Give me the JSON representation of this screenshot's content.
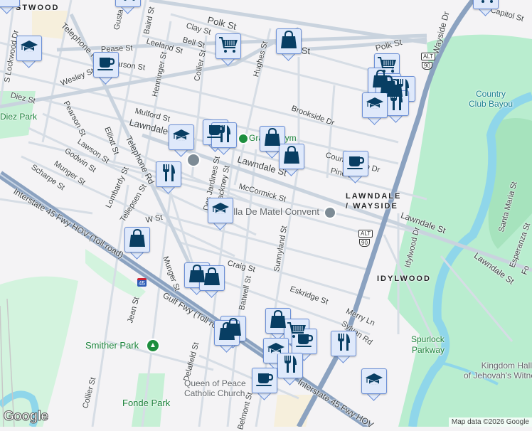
{
  "labels": {
    "eastwood": "STWOOD",
    "polk_w": "Polk St",
    "polk_mid": "Polk St",
    "polk_e": "Polk St",
    "clay": "Clay St",
    "bell": "Bell St",
    "leeland": "Leeland St",
    "baird": "Baird St",
    "gustav": "Gusta",
    "telephone_n": "Telephone Rd",
    "pease": "Pease St",
    "pearson_n": "Pearson St",
    "wesley": "Wesley St",
    "henninger": "Henninger St",
    "collier_n": "Collier St",
    "hughes": "Hughes St",
    "diez": "Diez St",
    "lockwood": "S Lockwood Dr",
    "mulford": "Mulford St",
    "lawndale_w": "Lawndale St",
    "lawndale_mid": "Lawndale St",
    "pearson_s": "Pearson St",
    "elliott": "Elliott St",
    "lawson": "Lawson St",
    "godwin": "Godwin St",
    "munger_n": "Munger St",
    "scharpe": "Scharpe St",
    "telephone_s": "Telephone Rd",
    "lombardy": "Lombardy St",
    "tellepsen": "Tellepsen St",
    "w_st": "W St",
    "desjardines": "Des Jardines St",
    "hackney": "Hackney St",
    "mccormick": "McCormick St",
    "brookside": "Brookside Dr",
    "countryclub_dr": "Country Club Dr",
    "pine": "Pine Dr",
    "wayside": "Wayside Dr",
    "capitol": "Capitol St",
    "lawndale_e1": "Lawndale St",
    "lawndale_e2": "Lawndale St",
    "idylwood_dr": "Idylwood Dr",
    "santamaria": "Santa Maria St",
    "esperanza": "Esperanza St",
    "fo": "Fo",
    "sunnyland": "Sunnyland St",
    "craig": "Craig St",
    "munger_s": "Munger St",
    "jean": "Jean St",
    "gulf_fwy": "Gulf Fwy (Toll road)",
    "i45_w": "Interstate 45 Fwy HOV (Toll road)",
    "i45_e": "Interstate 45 Fwy HOV",
    "eskridge": "Eskridge St",
    "merry": "Merry Ln",
    "sylvan": "Sylvan Rd",
    "delafield": "Delafield St",
    "collier_s": "Collier St",
    "batwell": "Batwell St",
    "belmont": "Belmont St"
  },
  "places": {
    "diez_park": "Diez Park",
    "gym": "Gravity Gym",
    "convent": "Villa De Matel Convent",
    "country_club_bayou_1": "Country",
    "country_club_bayou_2": "Club Bayou",
    "lawndale_wayside_1": "LAWNDALE",
    "lawndale_wayside_2": "/ WAYSIDE",
    "idylwood": "IDYLWOOD",
    "spurlock_1": "Spurlock",
    "spurlock_2": "Parkway",
    "kingdom_1": "Kingdom Hall",
    "kingdom_2": "of Jehovah's Witnesses",
    "smither_park": "Smither Park",
    "fonde_park": "Fonde Park",
    "queen_1": "Queen of Peace",
    "queen_2": "Catholic Church"
  },
  "shields": {
    "alt": "ALT",
    "us90": "90",
    "i45": "45"
  },
  "markers": [
    {
      "type": "school"
    },
    {
      "type": "cup"
    },
    {
      "type": "cart"
    },
    {
      "type": "bag"
    },
    {
      "type": "school"
    },
    {
      "type": "cart"
    },
    {
      "type": "cart"
    },
    {
      "type": "cart"
    },
    {
      "type": "bag"
    },
    {
      "type": "bag"
    },
    {
      "type": "bag"
    },
    {
      "type": "fork"
    },
    {
      "type": "fork"
    },
    {
      "type": "school"
    },
    {
      "type": "school"
    },
    {
      "type": "cup"
    },
    {
      "type": "fork"
    },
    {
      "type": "bag"
    },
    {
      "type": "bag"
    },
    {
      "type": "cup"
    },
    {
      "type": "fork"
    },
    {
      "type": "school"
    },
    {
      "type": "bag"
    },
    {
      "type": "bag"
    },
    {
      "type": "bag"
    },
    {
      "type": "bag"
    },
    {
      "type": "bag"
    },
    {
      "type": "bag"
    },
    {
      "type": "cart"
    },
    {
      "type": "cup"
    },
    {
      "type": "school"
    },
    {
      "type": "fork"
    },
    {
      "type": "cup"
    },
    {
      "type": "fork"
    },
    {
      "type": "school"
    }
  ],
  "logo": "Google",
  "attribution": "Map data ©2026 Google"
}
